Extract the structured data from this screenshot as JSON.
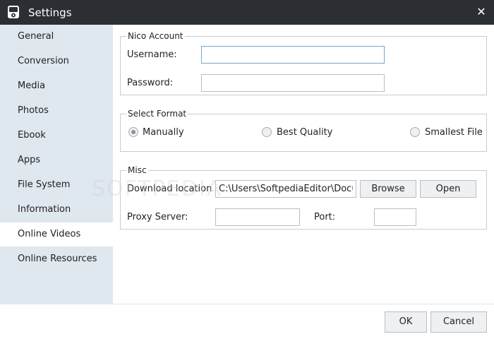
{
  "window": {
    "title": "Settings",
    "app_icon": "media-player-icon",
    "close_icon": "close-icon",
    "close_glyph": "✕"
  },
  "sidebar": {
    "items": [
      {
        "label": "General"
      },
      {
        "label": "Conversion"
      },
      {
        "label": "Media"
      },
      {
        "label": "Photos"
      },
      {
        "label": "Ebook"
      },
      {
        "label": "Apps"
      },
      {
        "label": "File System"
      },
      {
        "label": "Information"
      },
      {
        "label": "Online Videos",
        "active": true
      },
      {
        "label": "Online Resources"
      }
    ]
  },
  "nico_account": {
    "title": "Nico Account",
    "username_label": "Username:",
    "username_value": "",
    "password_label": "Password:",
    "password_value": ""
  },
  "select_format": {
    "title": "Select Format",
    "options": [
      {
        "label": "Manually",
        "checked": true
      },
      {
        "label": "Best Quality",
        "checked": false
      },
      {
        "label": "Smallest File",
        "checked": false
      }
    ]
  },
  "misc": {
    "title": "Misc",
    "download_label": "Download location",
    "download_value": "C:\\Users\\SoftpediaEditor\\Docu",
    "browse_label": "Browse",
    "open_label": "Open",
    "proxy_label": "Proxy Server:",
    "proxy_value": "",
    "port_label": "Port:",
    "port_value": ""
  },
  "footer": {
    "ok_label": "OK",
    "cancel_label": "Cancel"
  },
  "watermark": "SOFTPEDIA",
  "colors": {
    "titlebar": "#2b2f33",
    "sidebar": "#dfe7ef",
    "focus_border": "#6fa7cf"
  }
}
